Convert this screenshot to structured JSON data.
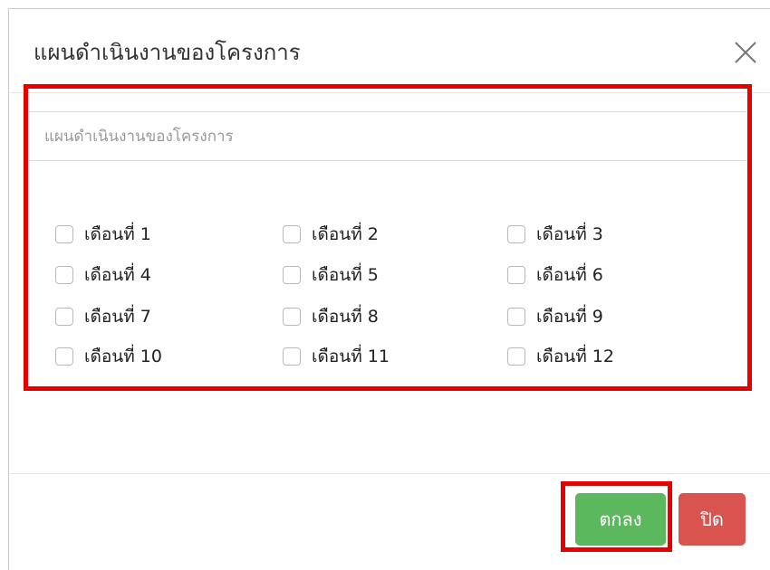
{
  "dialog": {
    "title": "แผนดำเนินงานของโครงการ",
    "close_icon": "close-icon"
  },
  "plan": {
    "placeholder": "แผนดำเนินงานของโครงการ",
    "value": ""
  },
  "months": [
    {
      "label": "เดือนที่ 1",
      "checked": false
    },
    {
      "label": "เดือนที่ 2",
      "checked": false
    },
    {
      "label": "เดือนที่ 3",
      "checked": false
    },
    {
      "label": "เดือนที่ 4",
      "checked": false
    },
    {
      "label": "เดือนที่ 5",
      "checked": false
    },
    {
      "label": "เดือนที่ 6",
      "checked": false
    },
    {
      "label": "เดือนที่ 7",
      "checked": false
    },
    {
      "label": "เดือนที่ 8",
      "checked": false
    },
    {
      "label": "เดือนที่ 9",
      "checked": false
    },
    {
      "label": "เดือนที่ 10",
      "checked": false
    },
    {
      "label": "เดือนที่ 11",
      "checked": false
    },
    {
      "label": "เดือนที่ 12",
      "checked": false
    }
  ],
  "footer": {
    "ok_label": "ตกลง",
    "close_label": "ปิด"
  },
  "colors": {
    "highlight": "#e60000",
    "ok_button": "#5cb85c",
    "close_button": "#d9534f"
  }
}
